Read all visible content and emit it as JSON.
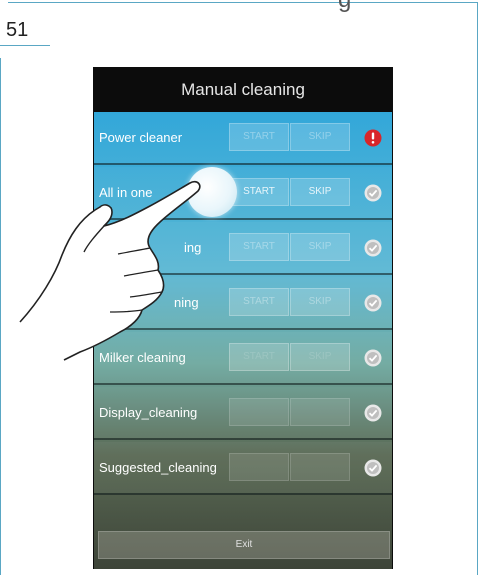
{
  "page": {
    "number": "51",
    "top_fragment": "g"
  },
  "screen": {
    "title": "Manual cleaning",
    "rows": [
      {
        "label": "Power cleaner",
        "start": "START",
        "skip": "SKIP",
        "status": "error"
      },
      {
        "label": "All in one",
        "start": "START",
        "skip": "SKIP",
        "status": "ok"
      },
      {
        "label": "ing",
        "start": "START",
        "skip": "SKIP",
        "status": "ok"
      },
      {
        "label": "ning",
        "start": "START",
        "skip": "SKIP",
        "status": "ok"
      },
      {
        "label": "Milker cleaning",
        "start": "START",
        "skip": "SKIP",
        "status": "ok"
      },
      {
        "label": "Display_cleaning",
        "start": "",
        "skip": "",
        "status": "ok"
      },
      {
        "label": "Suggested_cleaning",
        "start": "",
        "skip": "",
        "status": "ok"
      }
    ],
    "exit_label": "Exit"
  },
  "colors": {
    "accent": "#5aa7c4",
    "error": "#d8262a",
    "ok": "#e8e8e8"
  },
  "icons": {
    "error": "exclamation-icon",
    "ok": "check-icon",
    "hand": "pointing-hand-icon"
  }
}
